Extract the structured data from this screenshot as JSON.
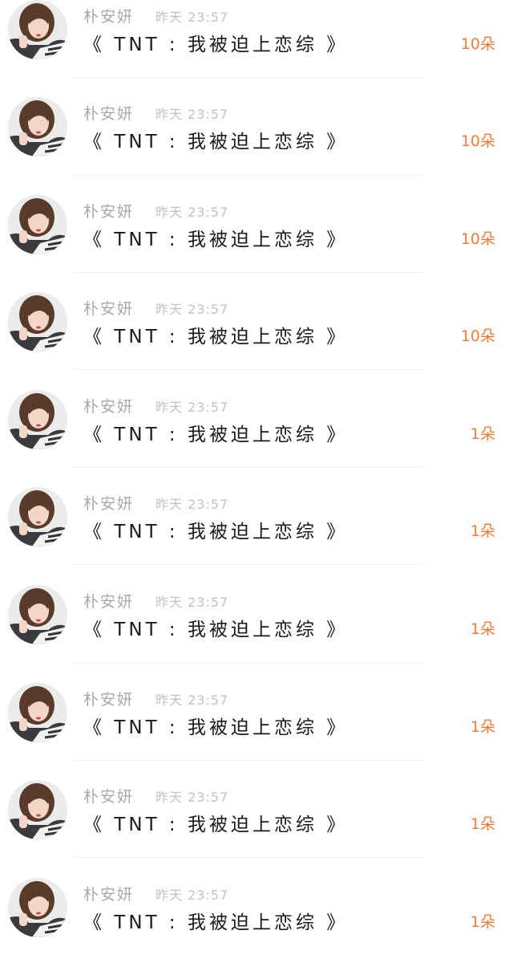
{
  "colors": {
    "name": "#a9a9a9",
    "time": "#c2c2c2",
    "title": "#1a1a1a",
    "count": "#ee7d3a"
  },
  "items": [
    {
      "name": "朴安妍",
      "time": "昨天 23:57",
      "title": "《 TNT : 我被迫上恋综 》",
      "count": "10朵"
    },
    {
      "name": "朴安妍",
      "time": "昨天 23:57",
      "title": "《 TNT : 我被迫上恋综 》",
      "count": "10朵"
    },
    {
      "name": "朴安妍",
      "time": "昨天 23:57",
      "title": "《 TNT : 我被迫上恋综 》",
      "count": "10朵"
    },
    {
      "name": "朴安妍",
      "time": "昨天 23:57",
      "title": "《 TNT : 我被迫上恋综 》",
      "count": "10朵"
    },
    {
      "name": "朴安妍",
      "time": "昨天 23:57",
      "title": "《 TNT : 我被迫上恋综 》",
      "count": "1朵"
    },
    {
      "name": "朴安妍",
      "time": "昨天 23:57",
      "title": "《 TNT : 我被迫上恋综 》",
      "count": "1朵"
    },
    {
      "name": "朴安妍",
      "time": "昨天 23:57",
      "title": "《 TNT : 我被迫上恋综 》",
      "count": "1朵"
    },
    {
      "name": "朴安妍",
      "time": "昨天 23:57",
      "title": "《 TNT : 我被迫上恋综 》",
      "count": "1朵"
    },
    {
      "name": "朴安妍",
      "time": "昨天 23:57",
      "title": "《 TNT : 我被迫上恋综 》",
      "count": "1朵"
    },
    {
      "name": "朴安妍",
      "time": "昨天 23:57",
      "title": "《 TNT : 我被迫上恋综 》",
      "count": "1朵"
    }
  ]
}
